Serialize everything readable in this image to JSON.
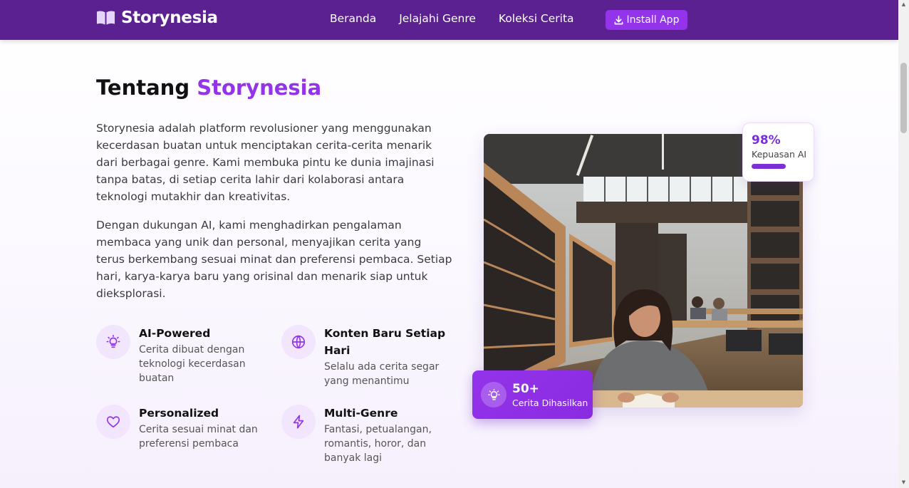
{
  "nav": {
    "brand": "Storynesia",
    "links": [
      "Beranda",
      "Jelajahi Genre",
      "Koleksi Cerita"
    ],
    "install_label": "Install App"
  },
  "about": {
    "heading_plain": "Tentang",
    "heading_accent": "Storynesia",
    "paragraphs": [
      "Storynesia adalah platform revolusioner yang menggunakan kecerdasan buatan untuk menciptakan cerita-cerita menarik dari berbagai genre. Kami membuka pintu ke dunia imajinasi tanpa batas, di setiap cerita lahir dari kolaborasi antara teknologi mutakhir dan kreativitas.",
      "Dengan dukungan AI, kami menghadirkan pengalaman membaca yang unik dan personal, menyajikan cerita yang terus berkembang sesuai minat dan preferensi pembaca. Setiap hari, karya-karya baru yang orisinal dan menarik siap untuk dieksplorasi."
    ],
    "features": [
      {
        "icon": "lightbulb-icon",
        "title": "AI-Powered",
        "desc": "Cerita dibuat dengan teknologi kecerdasan buatan"
      },
      {
        "icon": "globe-icon",
        "title": "Konten Baru Setiap Hari",
        "desc": "Selalu ada cerita segar yang menantimu"
      },
      {
        "icon": "heart-icon",
        "title": "Personalized",
        "desc": "Cerita sesuai minat dan preferensi pembaca"
      },
      {
        "icon": "bolt-icon",
        "title": "Multi-Genre",
        "desc": "Fantasi, petualangan, romantis, horor, dan banyak lagi"
      }
    ]
  },
  "image": {
    "alt": "woman-reading-in-library-photo"
  },
  "badges": {
    "satisfaction_value": "98%",
    "satisfaction_label": "Kepuasan AI",
    "satisfaction_level": 0.49,
    "stories_value": "50+",
    "stories_label": "Cerita Dihasilkan",
    "stories_icon": "lightbulb-icon"
  },
  "colors": {
    "nav_bg": "#5b2191",
    "accent": "#9333ea",
    "icon_bg": "#f1e6fd"
  }
}
